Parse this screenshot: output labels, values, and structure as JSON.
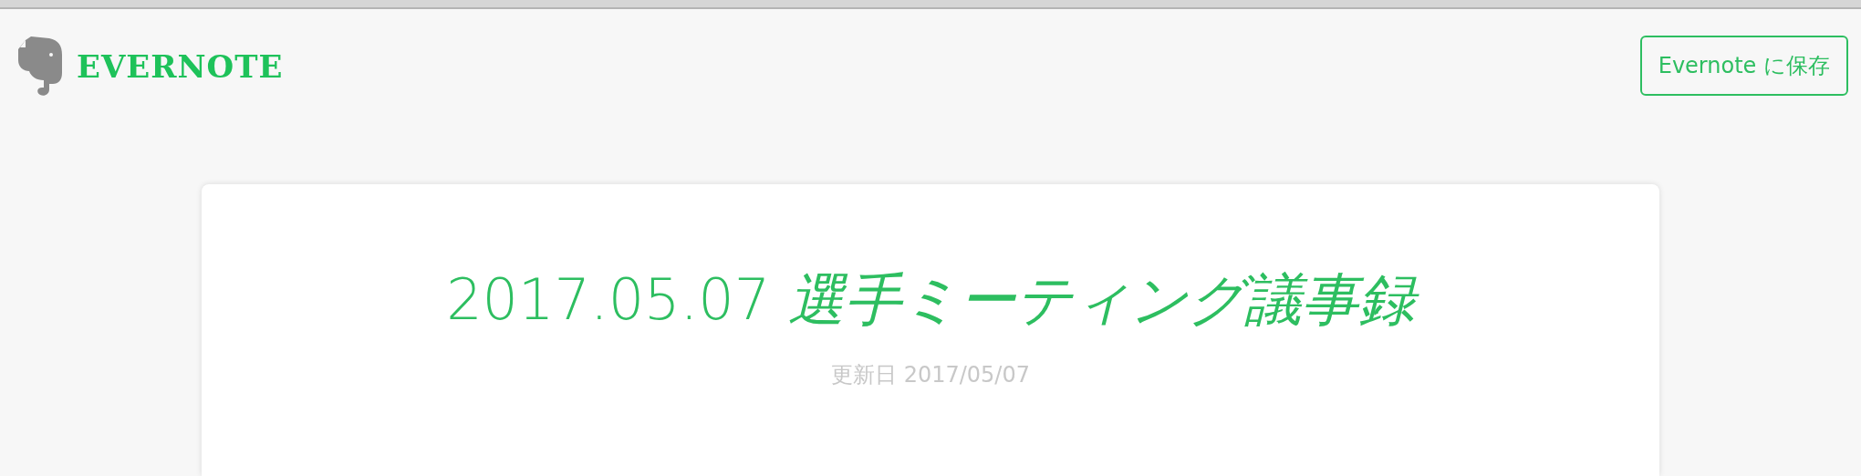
{
  "header": {
    "logo_text": "EVERNOTE",
    "save_button": "Evernote に保存"
  },
  "note": {
    "title": "2017.05.07 *選手ミーティング議事録*",
    "updated": "更新日 2017/05/07"
  }
}
